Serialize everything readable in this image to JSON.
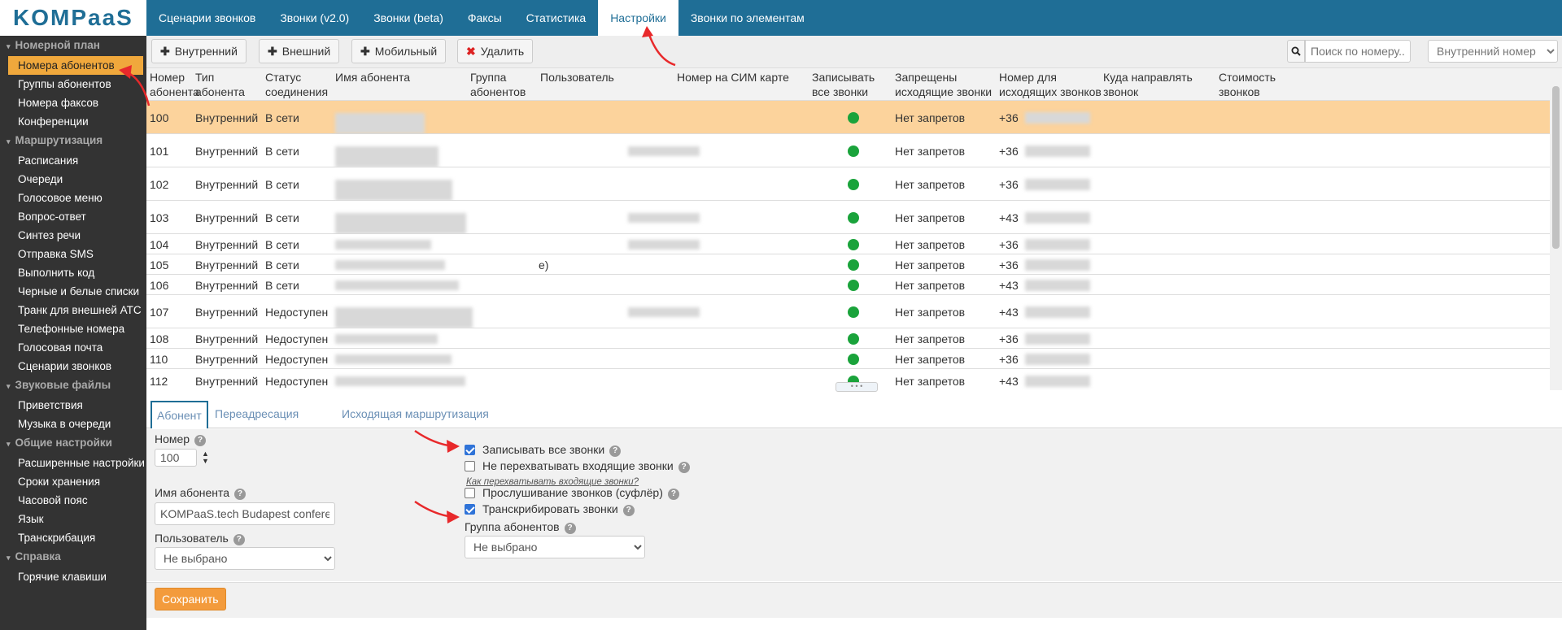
{
  "logo_text": "KOMPaaS",
  "topnav": [
    {
      "label": "Сценарии звонков"
    },
    {
      "label": "Звонки (v2.0)"
    },
    {
      "label": "Звонки (beta)"
    },
    {
      "label": "Факсы"
    },
    {
      "label": "Статистика"
    },
    {
      "label": "Настройки",
      "active": true
    },
    {
      "label": "Звонки по элементам"
    }
  ],
  "sidebar": {
    "sections": [
      {
        "title": "Номерной план",
        "items": [
          "Номера абонентов",
          "Группы абонентов",
          "Номера факсов",
          "Конференции"
        ]
      },
      {
        "title": "Маршрутизация",
        "items": [
          "Расписания",
          "Очереди",
          "Голосовое меню",
          "Вопрос-ответ",
          "Синтез речи",
          "Отправка SMS",
          "Выполнить код",
          "Черные и белые списки",
          "Транк для внешней АТС",
          "Телефонные номера",
          "Голосовая почта",
          "Сценарии звонков"
        ]
      },
      {
        "title": "Звуковые файлы",
        "items": [
          "Приветствия",
          "Музыка в очереди"
        ]
      },
      {
        "title": "Общие настройки",
        "items": [
          "Расширенные настройки",
          "Сроки хранения",
          "Часовой пояс",
          "Язык",
          "Транскрибация"
        ]
      },
      {
        "title": "Справка",
        "items": [
          "Горячие клавиши"
        ]
      }
    ],
    "active_item": "Номера абонентов"
  },
  "toolbar": {
    "internal_label": "Внутренний",
    "external_label": "Внешний",
    "mobile_label": "Мобильный",
    "delete_label": "Удалить",
    "search_placeholder": "Поиск по номеру...",
    "type_select_value": "Внутренний номер"
  },
  "table": {
    "headers": [
      "Номер абонента",
      "Тип абонента",
      "Статус соединения",
      "Имя абонента",
      "Группа абонентов",
      "Пользователь",
      "Номер на СИМ карте",
      "Записывать все звонки",
      "Запрещены исходящие звонки",
      "Номер для исходящих звонков",
      "Куда направлять звонок",
      "Стоимость звонков"
    ],
    "rows": [
      {
        "number": "100",
        "type": "Внутренний",
        "status": "В сети",
        "name_suffix": "",
        "record": true,
        "restrictions": "Нет запретов",
        "outgoing": "+36",
        "selected": true
      },
      {
        "number": "101",
        "type": "Внутренний",
        "status": "В сети",
        "name_suffix": "",
        "record": true,
        "restrictions": "Нет запретов",
        "outgoing": "+36"
      },
      {
        "number": "102",
        "type": "Внутренний",
        "status": "В сети",
        "name_suffix": "",
        "record": true,
        "restrictions": "Нет запретов",
        "outgoing": "+36"
      },
      {
        "number": "103",
        "type": "Внутренний",
        "status": "В сети",
        "name_suffix": "",
        "record": true,
        "restrictions": "Нет запретов",
        "outgoing": "+43"
      },
      {
        "number": "104",
        "type": "Внутренний",
        "status": "В сети",
        "name_suffix": "",
        "record": true,
        "restrictions": "Нет запретов",
        "outgoing": "+36"
      },
      {
        "number": "105",
        "type": "Внутренний",
        "status": "В сети",
        "name_suffix": "e)",
        "record": true,
        "restrictions": "Нет запретов",
        "outgoing": "+36"
      },
      {
        "number": "106",
        "type": "Внутренний",
        "status": "В сети",
        "name_suffix": "",
        "record": true,
        "restrictions": "Нет запретов",
        "outgoing": "+43"
      },
      {
        "number": "107",
        "type": "Внутренний",
        "status": "Недоступен",
        "name_suffix": "",
        "record": true,
        "restrictions": "Нет запретов",
        "outgoing": "+43"
      },
      {
        "number": "108",
        "type": "Внутренний",
        "status": "Недоступен",
        "name_suffix": "",
        "record": true,
        "restrictions": "Нет запретов",
        "outgoing": "+36"
      },
      {
        "number": "110",
        "type": "Внутренний",
        "status": "Недоступен",
        "name_suffix": "",
        "record": true,
        "restrictions": "Нет запретов",
        "outgoing": "+36"
      },
      {
        "number": "112",
        "type": "Внутренний",
        "status": "Недоступен",
        "name_suffix": "",
        "record": true,
        "restrictions": "Нет запретов",
        "outgoing": "+43"
      }
    ]
  },
  "tabs": [
    "Абонент",
    "Переадресация",
    "Исходящая маршрутизация"
  ],
  "form": {
    "number_label": "Номер",
    "number_value": "100",
    "name_label": "Имя абонента",
    "name_value": "KOMPaaS.tech Budapest confere",
    "user_label": "Пользователь",
    "user_value": "Не выбрано",
    "record_all_label": "Записывать все звонки",
    "record_all_checked": true,
    "no_intercept_label": "Не перехватывать входящие звонки",
    "no_intercept_checked": false,
    "how_intercept_link": "Как перехватывать входящие звонки?",
    "listen_label": "Прослушивание звонков (суфлёр)",
    "listen_checked": false,
    "transcribe_label": "Транскрибировать звонки",
    "transcribe_checked": true,
    "group_label": "Группа абонентов",
    "group_value": "Не выбрано"
  },
  "save_label": "Сохранить",
  "colors": {
    "header_blue": "#1f6e96",
    "accent_orange": "#f39b3c",
    "status_green": "#1aa33b",
    "arrow_red": "#e8292b"
  }
}
